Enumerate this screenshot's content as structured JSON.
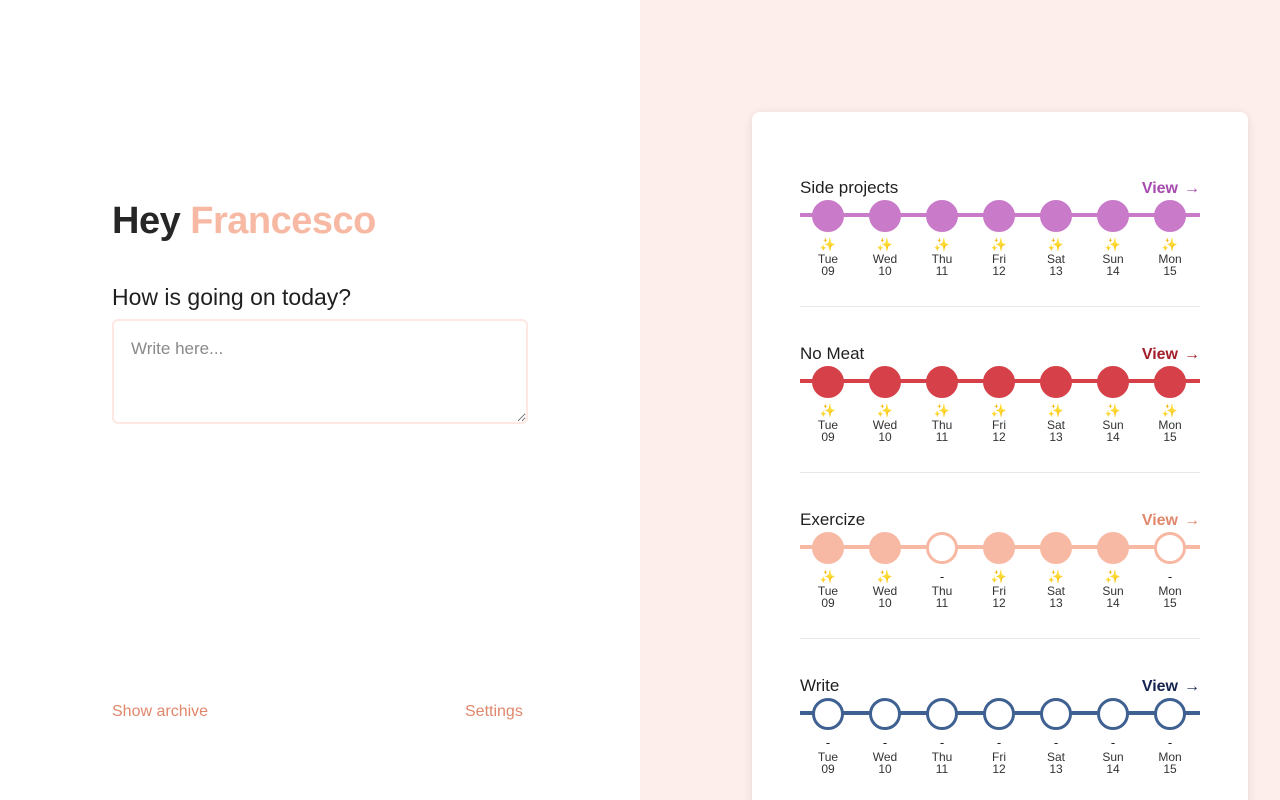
{
  "greeting": {
    "prefix": "Hey",
    "name": "Francesco"
  },
  "question": "How is going on today?",
  "entry": {
    "placeholder": "Write here...",
    "value": ""
  },
  "footer": {
    "archive_label": "Show archive",
    "settings_label": "Settings"
  },
  "habits": [
    {
      "title": "Side projects",
      "view_label": "View",
      "arrow": "→",
      "colors": {
        "accent": "#a74ab0",
        "line": "#c97bc9",
        "fill": "#c97bc9"
      },
      "days": [
        {
          "name": "Tue",
          "num": "09",
          "done": true,
          "mark": "✨"
        },
        {
          "name": "Wed",
          "num": "10",
          "done": true,
          "mark": "✨"
        },
        {
          "name": "Thu",
          "num": "11",
          "done": true,
          "mark": "✨"
        },
        {
          "name": "Fri",
          "num": "12",
          "done": true,
          "mark": "✨"
        },
        {
          "name": "Sat",
          "num": "13",
          "done": true,
          "mark": "✨"
        },
        {
          "name": "Sun",
          "num": "14",
          "done": true,
          "mark": "✨"
        },
        {
          "name": "Mon",
          "num": "15",
          "done": true,
          "mark": "✨"
        }
      ]
    },
    {
      "title": "No Meat",
      "view_label": "View",
      "arrow": "→",
      "colors": {
        "accent": "#a3202a",
        "line": "#d64048",
        "fill": "#d64048"
      },
      "days": [
        {
          "name": "Tue",
          "num": "09",
          "done": true,
          "mark": "✨"
        },
        {
          "name": "Wed",
          "num": "10",
          "done": true,
          "mark": "✨"
        },
        {
          "name": "Thu",
          "num": "11",
          "done": true,
          "mark": "✨"
        },
        {
          "name": "Fri",
          "num": "12",
          "done": true,
          "mark": "✨"
        },
        {
          "name": "Sat",
          "num": "13",
          "done": true,
          "mark": "✨"
        },
        {
          "name": "Sun",
          "num": "14",
          "done": true,
          "mark": "✨"
        },
        {
          "name": "Mon",
          "num": "15",
          "done": true,
          "mark": "✨"
        }
      ]
    },
    {
      "title": "Exercize",
      "view_label": "View",
      "arrow": "→",
      "colors": {
        "accent": "#e0876c",
        "line": "#f7b9a3",
        "fill": "#f7b9a3"
      },
      "days": [
        {
          "name": "Tue",
          "num": "09",
          "done": true,
          "mark": "✨"
        },
        {
          "name": "Wed",
          "num": "10",
          "done": true,
          "mark": "✨"
        },
        {
          "name": "Thu",
          "num": "11",
          "done": false,
          "mark": "-"
        },
        {
          "name": "Fri",
          "num": "12",
          "done": true,
          "mark": "✨"
        },
        {
          "name": "Sat",
          "num": "13",
          "done": true,
          "mark": "✨"
        },
        {
          "name": "Sun",
          "num": "14",
          "done": true,
          "mark": "✨"
        },
        {
          "name": "Mon",
          "num": "15",
          "done": false,
          "mark": "-"
        }
      ]
    },
    {
      "title": "Write",
      "view_label": "View",
      "arrow": "→",
      "colors": {
        "accent": "#15244f",
        "line": "#3f6191",
        "fill": "#3f6191"
      },
      "days": [
        {
          "name": "Tue",
          "num": "09",
          "done": false,
          "mark": "-"
        },
        {
          "name": "Wed",
          "num": "10",
          "done": false,
          "mark": "-"
        },
        {
          "name": "Thu",
          "num": "11",
          "done": false,
          "mark": "-"
        },
        {
          "name": "Fri",
          "num": "12",
          "done": false,
          "mark": "-"
        },
        {
          "name": "Sat",
          "num": "13",
          "done": false,
          "mark": "-"
        },
        {
          "name": "Sun",
          "num": "14",
          "done": false,
          "mark": "-"
        },
        {
          "name": "Mon",
          "num": "15",
          "done": false,
          "mark": "-"
        }
      ]
    }
  ]
}
